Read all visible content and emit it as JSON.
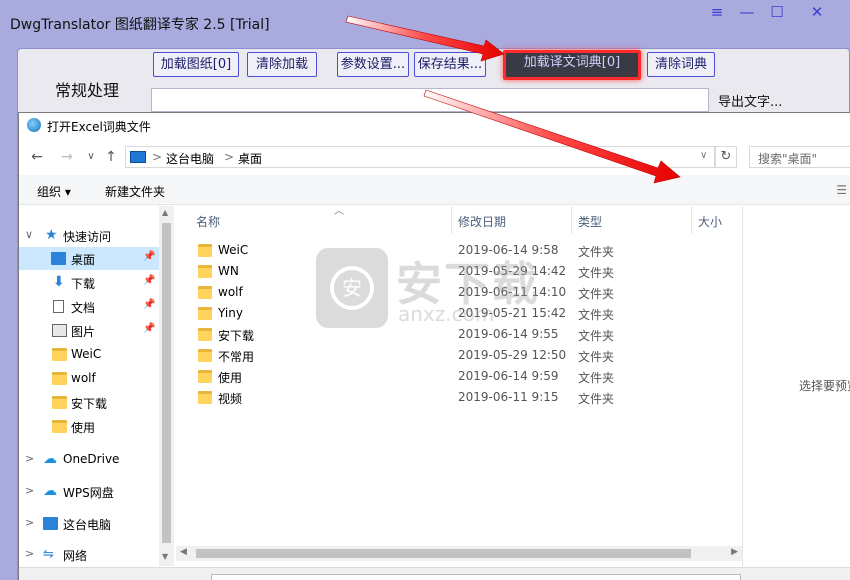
{
  "app": {
    "title": "DwgTranslator 图纸翻译专家 2.5 [Trial]",
    "window_controls": [
      "≡",
      "—",
      "☐",
      "✕"
    ],
    "side_title": "常规处理",
    "toolbar": {
      "load_drawing": "加载图纸[0]",
      "clear_load": "清除加载",
      "params": "参数设置...",
      "save_result": "保存结果...",
      "load_dictionary": "加载译文词典[0]",
      "clear_dictionary": "清除词典"
    },
    "export_text": "导出文字..."
  },
  "dialog": {
    "title": "打开Excel词典文件",
    "nav": {
      "back": "←",
      "forward": "→",
      "recent": "∨",
      "up": "↑"
    },
    "address": {
      "root": "这台电脑",
      "sep1": ">",
      "current": "桌面",
      "sep0": ">"
    },
    "refresh": "↻",
    "search_placeholder": "搜索\"桌面\"",
    "commands": {
      "organize": "组织 ▾",
      "new_folder": "新建文件夹"
    },
    "nav_pane": [
      {
        "label": "快速访问",
        "icon": "star-icon",
        "expand": "∨"
      },
      {
        "label": "桌面",
        "icon": "desktop-icon",
        "pinned": true,
        "selected": true
      },
      {
        "label": "下载",
        "icon": "download-icon",
        "pinned": true
      },
      {
        "label": "文档",
        "icon": "document-icon",
        "pinned": true
      },
      {
        "label": "图片",
        "icon": "picture-icon",
        "pinned": true
      },
      {
        "label": "WeiC",
        "icon": "folder-icon"
      },
      {
        "label": "wolf",
        "icon": "folder-icon"
      },
      {
        "label": "安下载",
        "icon": "folder-icon"
      },
      {
        "label": "使用",
        "icon": "folder-icon"
      },
      {
        "label": "OneDrive",
        "icon": "cloud-icon",
        "expand": ">"
      },
      {
        "label": "WPS网盘",
        "icon": "cloud-icon",
        "expand": ">"
      },
      {
        "label": "这台电脑",
        "icon": "computer-icon",
        "expand": ">"
      },
      {
        "label": "网络",
        "icon": "network-icon",
        "expand": ">"
      }
    ],
    "columns": {
      "name": "名称",
      "modified": "修改日期",
      "type": "类型",
      "size": "大小"
    },
    "files": [
      {
        "name": "WeiC",
        "date": "2019-06-14 9:58",
        "type": "文件夹"
      },
      {
        "name": "WN",
        "date": "2019-05-29 14:42",
        "type": "文件夹"
      },
      {
        "name": "wolf",
        "date": "2019-06-11 14:10",
        "type": "文件夹"
      },
      {
        "name": "Yiny",
        "date": "2019-05-21 15:42",
        "type": "文件夹"
      },
      {
        "name": "安下载",
        "date": "2019-06-14 9:55",
        "type": "文件夹"
      },
      {
        "name": "不常用",
        "date": "2019-05-29 12:50",
        "type": "文件夹"
      },
      {
        "name": "使用",
        "date": "2019-06-14 9:59",
        "type": "文件夹"
      },
      {
        "name": "视频",
        "date": "2019-06-11 9:15",
        "type": "文件夹"
      }
    ],
    "preview_hint": "选择要预览"
  },
  "watermark": {
    "big": "安下载",
    "small": "anxz.com",
    "glyph": "安"
  },
  "colors": {
    "accent": "#3b3fd0",
    "highlight": "#ff2a2a",
    "selection": "#cce8ff",
    "folder": "#ffd45c"
  }
}
